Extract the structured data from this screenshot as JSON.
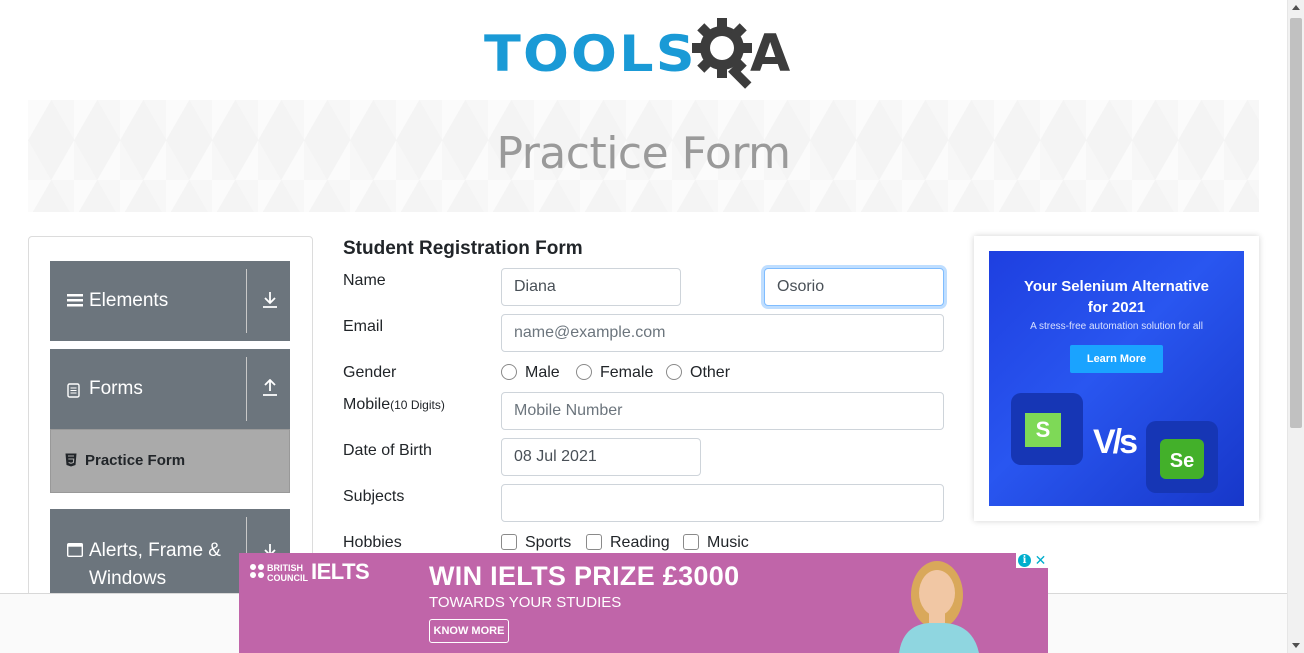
{
  "header": {
    "logo_text": "TOOLS",
    "logo_q_icon": "gear-magnifier-icon",
    "logo_a": "A",
    "banner_title": "Practice Form"
  },
  "sidebar": {
    "groups": [
      {
        "label": "Elements",
        "icon": "hamburger-icon",
        "toggle_icon": "download-arrow-icon"
      },
      {
        "label": "Forms",
        "icon": "document-icon",
        "toggle_icon": "upload-arrow-icon"
      },
      {
        "label": "Alerts, Frame & Windows",
        "icon": "window-icon",
        "toggle_icon": "download-arrow-icon"
      }
    ],
    "active_item": {
      "label": "Practice Form",
      "icon": "html5-icon"
    }
  },
  "form": {
    "title": "Student Registration Form",
    "name_label": "Name",
    "first_name_value": "Diana",
    "last_name_value": "Osorio",
    "email_label": "Email",
    "email_placeholder": "name@example.com",
    "gender_label": "Gender",
    "gender_options": [
      "Male",
      "Female",
      "Other"
    ],
    "mobile_label": "Mobile",
    "mobile_hint": "(10 Digits)",
    "mobile_placeholder": "Mobile Number",
    "dob_label": "Date of Birth",
    "dob_value": "08 Jul 2021",
    "subjects_label": "Subjects",
    "hobbies_label": "Hobbies",
    "hobby_options": [
      "Sports",
      "Reading",
      "Music"
    ]
  },
  "side_ad": {
    "headline_1": "Your Selenium Alternative",
    "headline_2": "for 2021",
    "tagline": "A stress-free automation solution for all",
    "button": "Learn More",
    "vs": "V/s",
    "logo_left": "S",
    "logo_right": "Se"
  },
  "bottom_ad": {
    "brand_1": "BRITISH",
    "brand_2": "COUNCIL",
    "brand_ielts": "IELTS",
    "headline": "WIN IELTS PRIZE £3000",
    "subline": "TOWARDS YOUR STUDIES",
    "cta": "KNOW MORE",
    "info_icon": "i",
    "close_icon": "✕"
  },
  "colors": {
    "brand_blue": "#1a9ad6",
    "sidebar_grey": "#6c757d",
    "active_item": "#aaaaaa",
    "ad_pink": "#c065a9",
    "ad_blue": "#2956f0"
  }
}
